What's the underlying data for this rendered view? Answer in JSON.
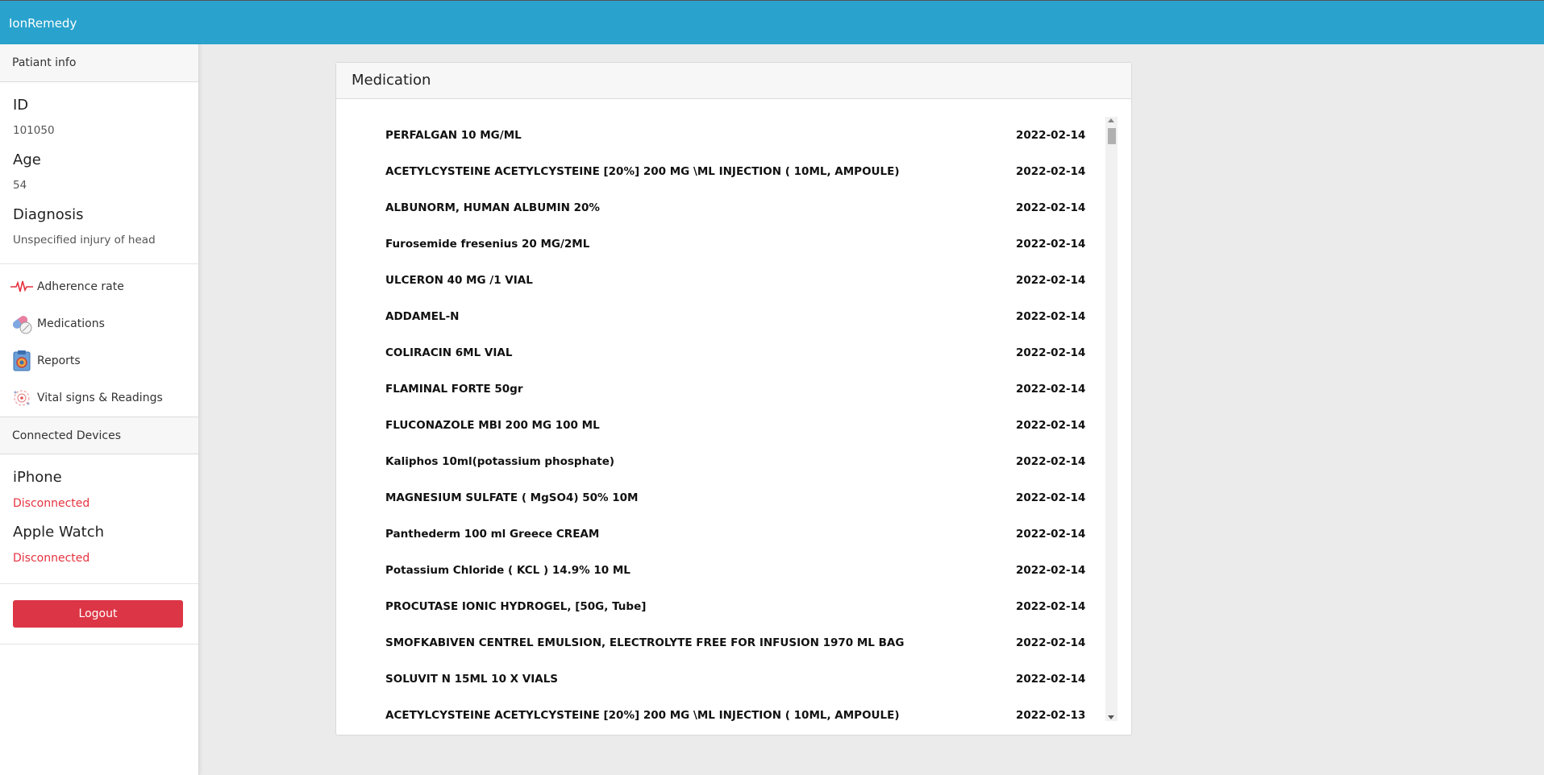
{
  "app": {
    "brand": "IonRemedy"
  },
  "sidebar": {
    "patient_header": "Patiant info",
    "id_label": "ID",
    "id_value": "101050",
    "age_label": "Age",
    "age_value": "54",
    "diagnosis_label": "Diagnosis",
    "diagnosis_value": "Unspecified injury of head",
    "nav": [
      {
        "label": "Adherence rate",
        "icon": "heartbeat-icon"
      },
      {
        "label": "Medications",
        "icon": "pills-icon"
      },
      {
        "label": "Reports",
        "icon": "report-clipboard-icon"
      },
      {
        "label": "Vital signs & Readings",
        "icon": "vital-signs-icon"
      }
    ],
    "devices_header": "Connected Devices",
    "devices": [
      {
        "name": "iPhone",
        "status": "Disconnected"
      },
      {
        "name": "Apple Watch",
        "status": "Disconnected"
      }
    ],
    "logout_label": "Logout"
  },
  "main": {
    "card_title": "Medication",
    "medications": [
      {
        "name": "PERFALGAN 10 MG/ML",
        "date": "2022-02-14"
      },
      {
        "name": "ACETYLCYSTEINE ACETYLCYSTEINE [20%] 200 MG \\ML INJECTION ( 10ML, AMPOULE)",
        "date": "2022-02-14"
      },
      {
        "name": "ALBUNORM, HUMAN ALBUMIN 20%",
        "date": "2022-02-14"
      },
      {
        "name": "Furosemide fresenius 20 MG/2ML",
        "date": "2022-02-14"
      },
      {
        "name": "ULCERON 40 MG /1 VIAL",
        "date": "2022-02-14"
      },
      {
        "name": "ADDAMEL-N",
        "date": "2022-02-14"
      },
      {
        "name": "COLIRACIN 6ML VIAL",
        "date": "2022-02-14"
      },
      {
        "name": "FLAMINAL FORTE 50gr",
        "date": "2022-02-14"
      },
      {
        "name": "FLUCONAZOLE MBI 200 MG 100 ML",
        "date": "2022-02-14"
      },
      {
        "name": "Kaliphos 10ml(potassium phosphate)",
        "date": "2022-02-14"
      },
      {
        "name": "MAGNESIUM SULFATE ( MgSO4) 50% 10M",
        "date": "2022-02-14"
      },
      {
        "name": "Panthederm 100 ml Greece CREAM",
        "date": "2022-02-14"
      },
      {
        "name": "Potassium Chloride ( KCL ) 14.9% 10 ML",
        "date": "2022-02-14"
      },
      {
        "name": "PROCUTASE IONIC HYDROGEL, [50G, Tube]",
        "date": "2022-02-14"
      },
      {
        "name": "SMOFKABIVEN CENTREL EMULSION, ELECTROLYTE FREE FOR INFUSION 1970 ML BAG",
        "date": "2022-02-14"
      },
      {
        "name": "SOLUVIT N 15ML 10 X VIALS",
        "date": "2022-02-14"
      },
      {
        "name": "ACETYLCYSTEINE ACETYLCYSTEINE [20%] 200 MG \\ML INJECTION ( 10ML, AMPOULE)",
        "date": "2022-02-13"
      }
    ]
  },
  "colors": {
    "topbar": "#29a3cd",
    "danger": "#dc3545",
    "disconnected": "#e5323f"
  }
}
